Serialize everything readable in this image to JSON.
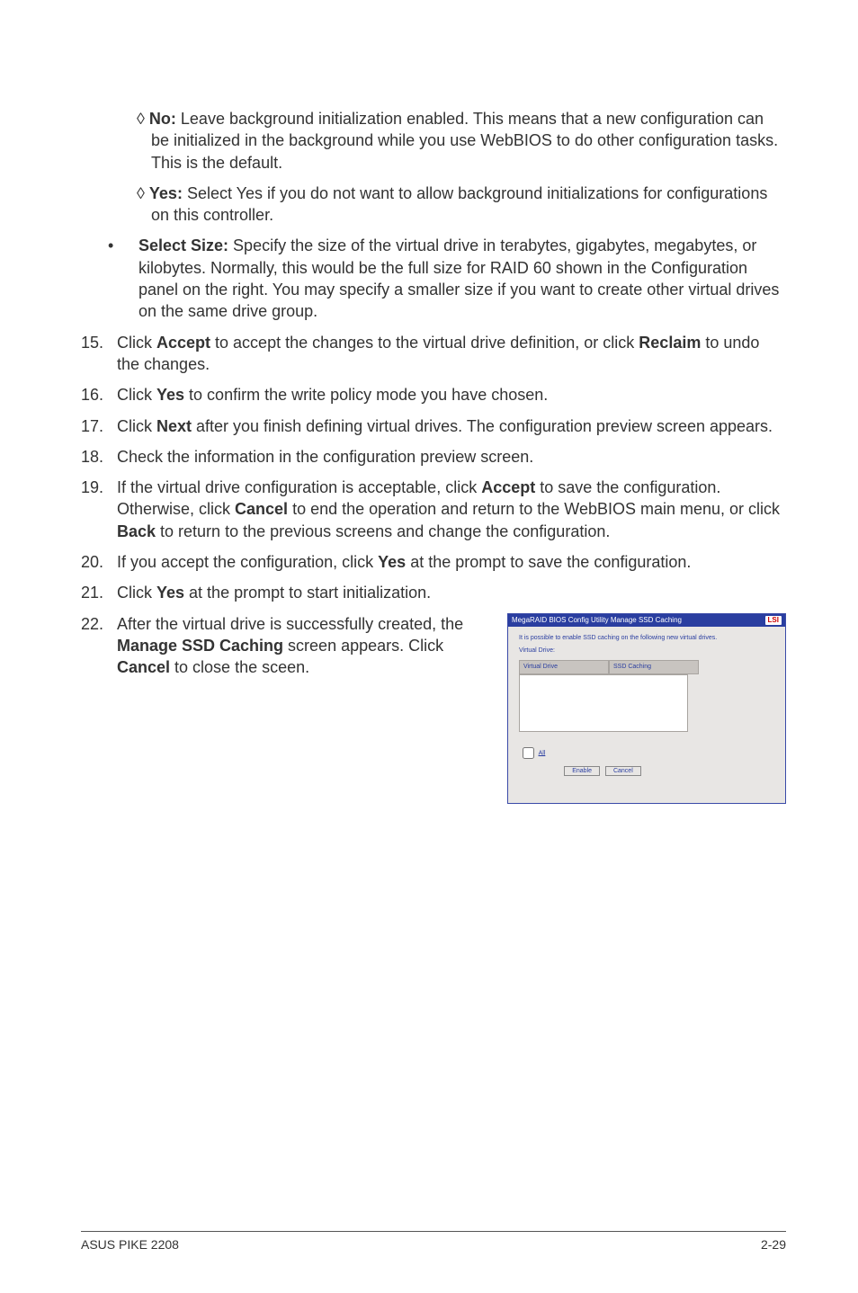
{
  "sub2a": {
    "label": "No:",
    "text": " Leave background initialization enabled. This means that a new configuration can be initialized in the background while you use WebBIOS to do other configuration tasks. This is the default."
  },
  "sub2b": {
    "label": "Yes:",
    "text": " Select Yes if you do not want to allow background initializations for configurations on this controller."
  },
  "bullet": {
    "label": "Select Size:",
    "text": " Specify the size of the virtual drive in terabytes, gigabytes, megabytes, or kilobytes. Normally, this would be the full size for RAID 60 shown in the Configuration panel on the right. You may specify a smaller size if you want to create other virtual drives on the same drive group."
  },
  "s15": {
    "num": "15.",
    "pre": "Click ",
    "b1": "Accept",
    "mid": " to accept the changes to the virtual drive definition, or click ",
    "b2": "Reclaim",
    "post": " to undo the changes."
  },
  "s16": {
    "num": "16.",
    "pre": "Click ",
    "b1": "Yes",
    "post": " to confirm the write policy mode you have chosen."
  },
  "s17": {
    "num": "17.",
    "pre": "Click ",
    "b1": "Next",
    "post": " after you finish defining virtual drives. The configuration preview screen appears."
  },
  "s18": {
    "num": "18.",
    "text": "Check the information in the configuration preview screen."
  },
  "s19": {
    "num": "19.",
    "pre": "If the virtual drive configuration is acceptable, click ",
    "b1": "Accept",
    "mid1": " to save the configuration. Otherwise, click ",
    "b2": "Cancel",
    "mid2": " to end the operation and return to the WebBIOS main menu, or click ",
    "b3": "Back",
    "post": " to return to the previous screens and change the configuration."
  },
  "s20": {
    "num": "20.",
    "pre": "If you accept the configuration, click ",
    "b1": "Yes",
    "post": " at the prompt to save the configuration."
  },
  "s21": {
    "num": "21.",
    "pre": "Click ",
    "b1": "Yes",
    "post": " at the prompt to start initialization."
  },
  "s22": {
    "num": "22.",
    "pre": "After the virtual drive is successfully created, the ",
    "b1": "Manage SSD Caching",
    "mid": " screen appears. Click ",
    "b2": "Cancel",
    "post": " to close the sceen."
  },
  "shot": {
    "title": "MegaRAID BIOS Config Utility Manage SSD Caching",
    "logo": "LSI",
    "msg": "It is possible to enable SSD caching on the following new virtual drives.",
    "label1": "Virtual Drive:",
    "th1": "Virtual Drive",
    "th2": "SSD Caching",
    "all": "All",
    "btn1": "Enable",
    "btn2": "Cancel"
  },
  "footer": {
    "left": "ASUS PIKE 2208",
    "right": "2-29"
  }
}
